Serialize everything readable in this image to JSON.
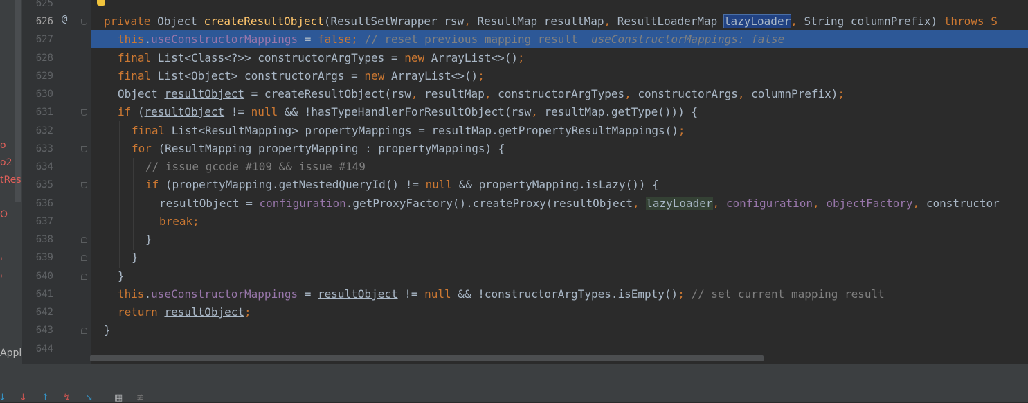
{
  "left_panel": {
    "fragments": [
      "o",
      "o2",
      "tRes",
      "O",
      "'",
      "'",
      "Appl"
    ]
  },
  "gutter": {
    "line_numbers": [
      "625",
      "626",
      "627",
      "628",
      "629",
      "630",
      "631",
      "632",
      "633",
      "634",
      "635",
      "636",
      "637",
      "638",
      "639",
      "640",
      "641",
      "642",
      "643",
      "644"
    ],
    "override_marker": "@"
  },
  "code": {
    "l626": {
      "t1": "private",
      "t2": " Object ",
      "t3": "createResultObject",
      "t4": "(ResultSetWrapper rsw",
      "t5": ", ",
      "t6": "ResultMap resultMap",
      "t7": ", ",
      "t8": "ResultLoaderMap ",
      "t9": "lazyLoader",
      "t10": ", ",
      "t11": "String columnPrefix) ",
      "t12": "throws S"
    },
    "l627": {
      "t1": "this",
      "t2": ".",
      "t3": "useConstructorMappings",
      "t4": " = ",
      "t5": "false",
      "t6": "; ",
      "t7": "// reset previous mapping result  ",
      "t8": "useConstructorMappings: false"
    },
    "l628": {
      "t1": "final ",
      "t2": "List<Class<?>> constructorArgTypes = ",
      "t3": "new ",
      "t4": "ArrayList<>()",
      "t5": ";"
    },
    "l629": {
      "t1": "final ",
      "t2": "List<Object> constructorArgs = ",
      "t3": "new ",
      "t4": "ArrayList<>()",
      "t5": ";"
    },
    "l630": {
      "t1": "Object ",
      "t2": "resultObject",
      "t3": " = createResultObject(rsw",
      "t4": ", ",
      "t5": "resultMap",
      "t6": ", ",
      "t7": "constructorArgTypes",
      "t8": ", ",
      "t9": "constructorArgs",
      "t10": ", ",
      "t11": "columnPrefix)",
      "t12": ";"
    },
    "l631": {
      "t1": "if ",
      "t2": "(",
      "t3": "resultObject",
      "t4": " != ",
      "t5": "null ",
      "t6": "&& !hasTypeHandlerForResultObject(rsw",
      "t7": ", ",
      "t8": "resultMap.getType())) {"
    },
    "l632": {
      "t1": "final ",
      "t2": "List<ResultMapping> propertyMappings = resultMap.getPropertyResultMappings()",
      "t3": ";"
    },
    "l633": {
      "t1": "for ",
      "t2": "(ResultMapping propertyMapping : propertyMappings) {"
    },
    "l634": {
      "t1": "// issue gcode #109 && issue #149"
    },
    "l635": {
      "t1": "if ",
      "t2": "(propertyMapping.getNestedQueryId() != ",
      "t3": "null ",
      "t4": "&& propertyMapping.isLazy()) {"
    },
    "l636": {
      "t1": "resultObject",
      "t2": " = ",
      "t3": "configuration",
      "t4": ".getProxyFactory().createProxy(",
      "t5": "resultObject",
      "t6": ", ",
      "t7": "lazyLoader",
      "t8": ", ",
      "t9": "configuration",
      "t10": ", ",
      "t11": "objectFactory",
      "t12": ", ",
      "t13": "constructor"
    },
    "l637": {
      "t1": "break",
      "t2": ";"
    },
    "l638": {
      "t1": "}"
    },
    "l639": {
      "t1": "}"
    },
    "l640": {
      "t1": "}"
    },
    "l641": {
      "t1": "this",
      "t2": ".",
      "t3": "useConstructorMappings",
      "t4": " = ",
      "t5": "resultObject",
      "t6": " != ",
      "t7": "null ",
      "t8": "&& !constructorArgTypes.isEmpty()",
      "t9": "; ",
      "t10": "// set current mapping result"
    },
    "l642": {
      "t1": "return ",
      "t2": "resultObject",
      "t3": ";"
    },
    "l643": {
      "t1": "}"
    }
  },
  "toolbar": {
    "icons": [
      "step-over-icon",
      "step-into-icon",
      "step-out-icon",
      "drop-frame-icon",
      "run-to-cursor-icon",
      "evaluate-icon",
      "trace-icon"
    ]
  },
  "colors": {
    "keyword": "#cc7832",
    "method": "#ffc66d",
    "field": "#9876aa",
    "comment": "#808080",
    "execution_line": "#2d5897",
    "selection": "#214283"
  }
}
